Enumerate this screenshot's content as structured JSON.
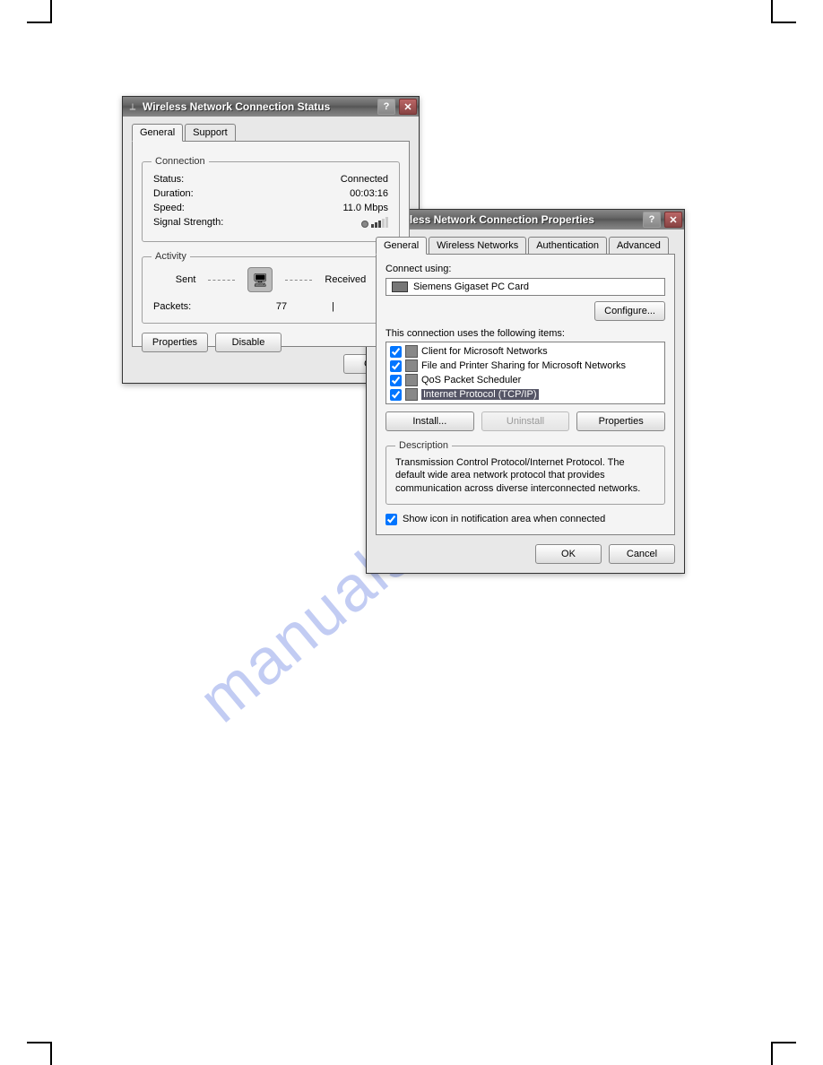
{
  "watermark": "manualshive.com",
  "status_window": {
    "title": "Wireless Network Connection Status",
    "tabs": {
      "general": "General",
      "support": "Support"
    },
    "connection": {
      "legend": "Connection",
      "status_label": "Status:",
      "status_value": "Connected",
      "duration_label": "Duration:",
      "duration_value": "00:03:16",
      "speed_label": "Speed:",
      "speed_value": "11.0 Mbps",
      "signal_label": "Signal Strength:"
    },
    "activity": {
      "legend": "Activity",
      "sent_label": "Sent",
      "received_label": "Received",
      "packets_label": "Packets:",
      "packets_sent": "77",
      "packets_recv_sep": "|"
    },
    "buttons": {
      "properties": "Properties",
      "disable": "Disable",
      "close": "Close"
    }
  },
  "props_window": {
    "title": "Wireless Network Connection Properties",
    "tabs": {
      "general": "General",
      "wireless": "Wireless Networks",
      "auth": "Authentication",
      "advanced": "Advanced"
    },
    "connect_using_label": "Connect using:",
    "adapter_name": "Siemens Gigaset PC Card",
    "configure_btn": "Configure...",
    "items_label": "This connection uses the following items:",
    "items": [
      {
        "checked": true,
        "name": "Client for Microsoft Networks"
      },
      {
        "checked": true,
        "name": "File and Printer Sharing for Microsoft Networks"
      },
      {
        "checked": true,
        "name": "QoS Packet Scheduler"
      },
      {
        "checked": true,
        "name": "Internet Protocol (TCP/IP)",
        "selected": true
      }
    ],
    "item_buttons": {
      "install": "Install...",
      "uninstall": "Uninstall",
      "properties": "Properties"
    },
    "description": {
      "legend": "Description",
      "text": "Transmission Control Protocol/Internet Protocol. The default wide area network protocol that provides communication across diverse interconnected networks."
    },
    "show_icon_label": "Show icon in notification area when connected",
    "buttons": {
      "ok": "OK",
      "cancel": "Cancel"
    }
  }
}
